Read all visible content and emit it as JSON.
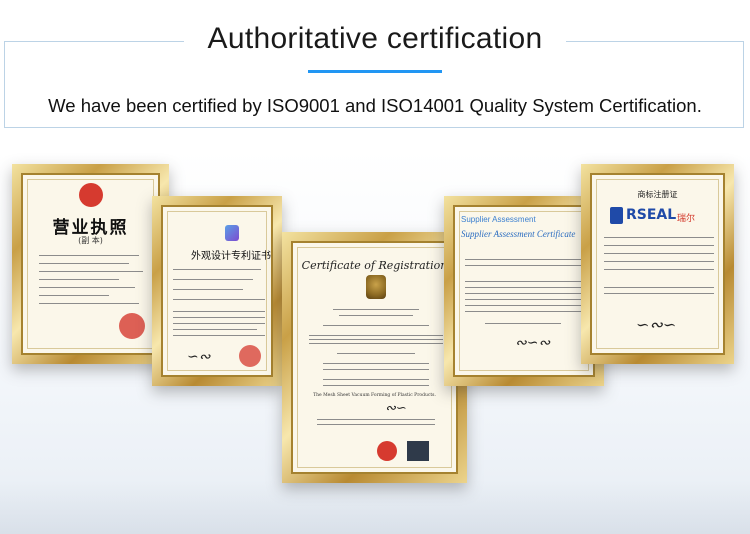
{
  "header": {
    "title": "Authoritative certification",
    "subtitle": "We have been certified by ISO9001 and ISO14001 Quality System Certification."
  },
  "certificates": [
    {
      "title": "营业执照",
      "subtitle": "(副 本)"
    },
    {
      "title": "外观设计专利证书"
    },
    {
      "title": "Certificate of Registration",
      "product": "The Mesh Sheet Vacuum Forming of Plastic Products."
    },
    {
      "brand": "Supplier Assessment",
      "title": "Supplier Assessment Certificate"
    },
    {
      "title": "商标注册证",
      "logo": "RSEAL",
      "logo_cn": "瑞尔"
    }
  ],
  "colors": {
    "accent": "#2196f3",
    "frame_gold": "#c9a047",
    "seal_red": "#d63a2f"
  }
}
